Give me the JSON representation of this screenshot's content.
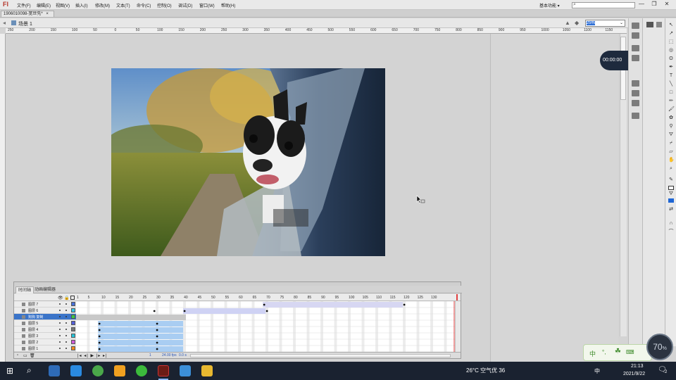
{
  "app": {
    "logo": "Fl",
    "menu": [
      "文件(F)",
      "编辑(E)",
      "视图(V)",
      "插入(I)",
      "修改(M)",
      "文本(T)",
      "命令(C)",
      "控制(O)",
      "调试(D)",
      "窗口(W)",
      "帮助(H)"
    ],
    "workspace": "基本功能 ▾",
    "search_placeholder": "",
    "window_buttons": [
      "—",
      "❐",
      "✕"
    ]
  },
  "document": {
    "tab_title": "1906010098-宽世先*",
    "tab_close": "×",
    "scene": "场景 1",
    "zoom": "25%"
  },
  "ruler": {
    "labels": [
      "250",
      "200",
      "150",
      "100",
      "50",
      "0",
      "50",
      "100",
      "150",
      "200",
      "250",
      "300",
      "350",
      "400",
      "450",
      "500",
      "550",
      "600",
      "650",
      "700",
      "750",
      "800",
      "850",
      "900",
      "950",
      "1000",
      "1050",
      "1100",
      "1150",
      "1200"
    ]
  },
  "recorder": {
    "time": "00:00:00"
  },
  "timeline": {
    "tabs": [
      "时间轴",
      "动画编辑器"
    ],
    "frame_numbers": [
      "1",
      "5",
      "10",
      "15",
      "20",
      "25",
      "30",
      "35",
      "40",
      "45",
      "50",
      "55",
      "60",
      "65",
      "70",
      "75",
      "80",
      "85",
      "90",
      "95",
      "100",
      "105",
      "110",
      "115",
      "120",
      "125",
      "130"
    ],
    "layers": [
      {
        "name": "图层 7",
        "color": "#4a72d8",
        "selected": false
      },
      {
        "name": "图层 6",
        "color": "#37c7e8",
        "selected": false
      },
      {
        "name": "狗狗 复制",
        "color": "#3fc744",
        "selected": true
      },
      {
        "name": "图层 5",
        "color": "#5560d8",
        "selected": false
      },
      {
        "name": "图层 4",
        "color": "#777777",
        "selected": false
      },
      {
        "name": "图层 3",
        "color": "#27c3d8",
        "selected": false
      },
      {
        "name": "图层 2",
        "color": "#d05cd8",
        "selected": false
      },
      {
        "name": "图层 1",
        "color": "#f08a20",
        "selected": false
      }
    ],
    "status_frame": "1",
    "status_fps": "24.00 fps",
    "status_time": "0.0 s"
  },
  "taskbar": {
    "weather": "26°C 空气优 36",
    "ime": "中",
    "time": "21:13",
    "date": "2021/9/22",
    "notif": "2"
  },
  "widgets": {
    "ime_bar": "中",
    "cpu": "70",
    "cpu_unit": "%"
  }
}
